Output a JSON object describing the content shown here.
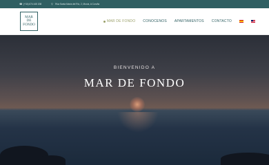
{
  "topbar": {
    "phone": "(+34) 674 445 208",
    "address": "Rúa Santa María del Río, 2, Muxía, A Coruña"
  },
  "logo": {
    "line1": "MAR",
    "line2": "DE",
    "line3": "FONDO"
  },
  "nav": {
    "items": [
      {
        "label": "MAR DE FONDO"
      },
      {
        "label": "CONOCENOS"
      },
      {
        "label": "APARTAMENTOS"
      },
      {
        "label": "CONTACTO"
      }
    ],
    "languages": [
      "es",
      "en"
    ]
  },
  "hero": {
    "subtitle": "BIENVENIDO A",
    "title": "MAR DE FONDO"
  }
}
